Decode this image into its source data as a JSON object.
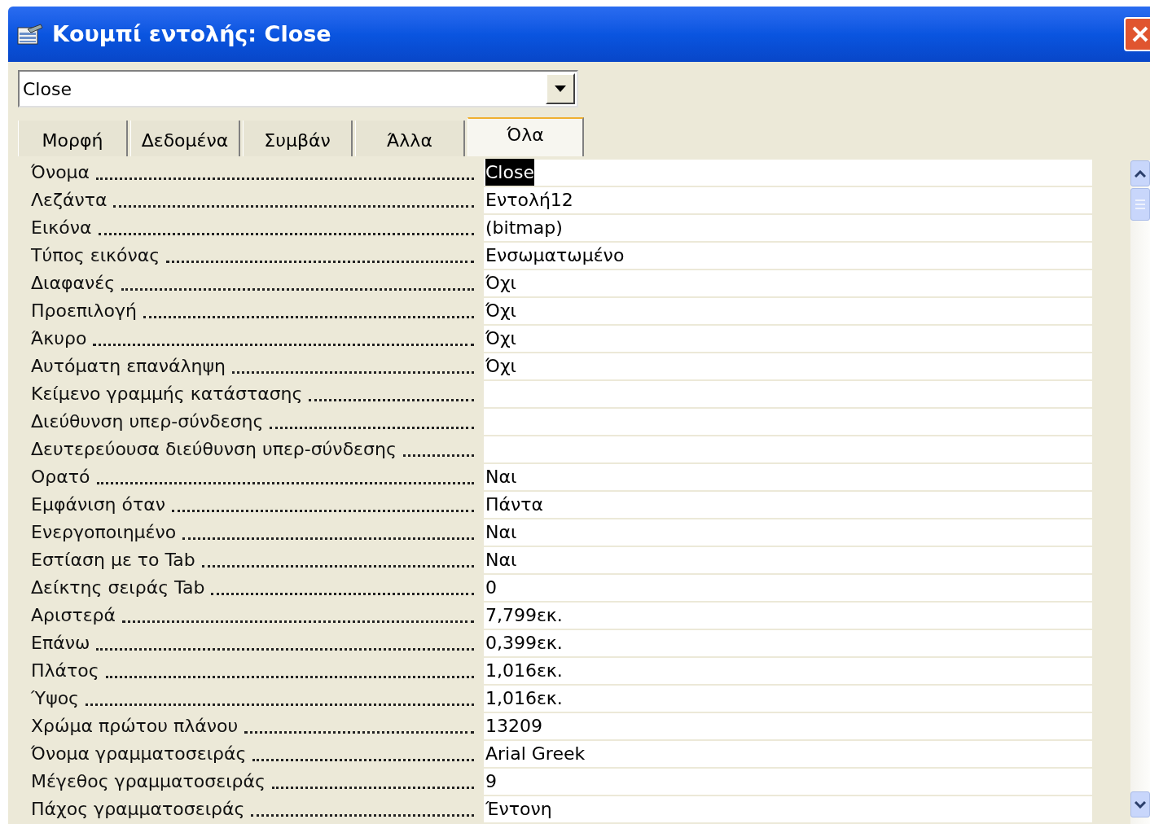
{
  "window": {
    "title": "Κουμπί εντολής: Close"
  },
  "object_select": {
    "value": "Close"
  },
  "tabs": [
    {
      "label": "Μορφή",
      "selected": false
    },
    {
      "label": "Δεδομένα",
      "selected": false
    },
    {
      "label": "Συμβάν",
      "selected": false
    },
    {
      "label": "Άλλα",
      "selected": false
    },
    {
      "label": "Όλα",
      "selected": true
    }
  ],
  "properties": [
    {
      "label": "Όνομα",
      "value": "Close",
      "selected": true
    },
    {
      "label": "Λεζάντα",
      "value": "Εντολή12",
      "selected": false
    },
    {
      "label": "Εικόνα",
      "value": "(bitmap)",
      "selected": false
    },
    {
      "label": "Τύπος εικόνας",
      "value": "Ενσωματωμένο",
      "selected": false
    },
    {
      "label": "Διαφανές",
      "value": "Όχι",
      "selected": false
    },
    {
      "label": "Προεπιλογή",
      "value": "Όχι",
      "selected": false
    },
    {
      "label": "Άκυρο",
      "value": "Όχι",
      "selected": false
    },
    {
      "label": "Αυτόματη επανάληψη",
      "value": "Όχι",
      "selected": false
    },
    {
      "label": "Κείμενο γραμμής κατάστασης",
      "selected": false
    },
    {
      "label": "Διεύθυνση υπερ-σύνδεσης",
      "selected": false
    },
    {
      "label": "Δευτερεύουσα διεύθυνση υπερ-σύνδεσης",
      "selected": false
    },
    {
      "label": "Ορατό",
      "value": "Ναι",
      "selected": false
    },
    {
      "label": "Εμφάνιση όταν",
      "value": "Πάντα",
      "selected": false
    },
    {
      "label": "Ενεργοποιημένο",
      "value": "Ναι",
      "selected": false
    },
    {
      "label": "Εστίαση με το Tab",
      "value": "Ναι",
      "selected": false
    },
    {
      "label": "Δείκτης σειράς Tab",
      "value": "0",
      "selected": false
    },
    {
      "label": "Αριστερά",
      "value": "7,799εκ.",
      "selected": false
    },
    {
      "label": "Επάνω",
      "value": "0,399εκ.",
      "selected": false
    },
    {
      "label": "Πλάτος",
      "value": "1,016εκ.",
      "selected": false
    },
    {
      "label": "Ύψος",
      "value": "1,016εκ.",
      "selected": false
    },
    {
      "label": "Χρώμα πρώτου πλάνου",
      "value": "13209",
      "selected": false
    },
    {
      "label": "Όνομα γραμματοσειράς",
      "value": "Arial Greek",
      "selected": false
    },
    {
      "label": "Μέγεθος γραμματοσειράς",
      "value": "9",
      "selected": false
    },
    {
      "label": "Πάχος γραμματοσειράς",
      "value": "Έντονη",
      "selected": false
    }
  ]
}
